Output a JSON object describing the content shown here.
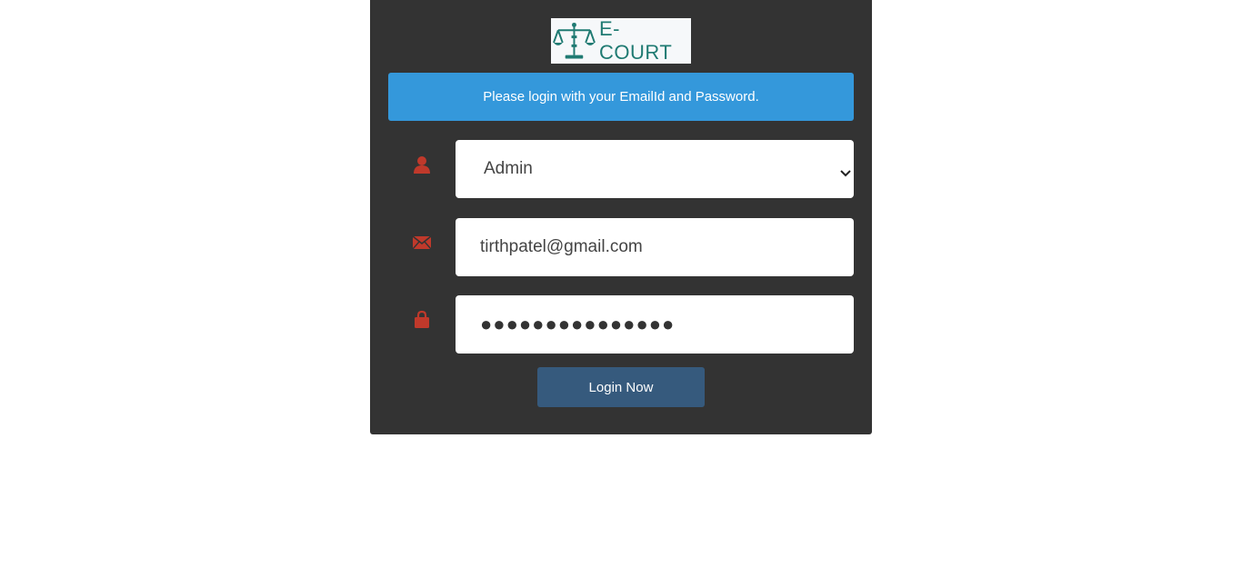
{
  "branding": {
    "logo_text": "E-COURT",
    "logo_color": "#1f7a72"
  },
  "alert": {
    "message": "Please login with your EmailId and Password.",
    "color": "#3498db"
  },
  "form": {
    "role_select": {
      "icon": "user-icon",
      "selected": "Admin"
    },
    "email": {
      "icon": "envelope-icon",
      "value": "tirthpatel@gmail.com"
    },
    "password": {
      "icon": "lock-icon",
      "masked_value": "●●●●●●●●●●●●●●●"
    },
    "icon_color": "#c0392b",
    "submit_label": "Login Now",
    "submit_color": "#365a7d"
  },
  "panel_color": "#333333"
}
